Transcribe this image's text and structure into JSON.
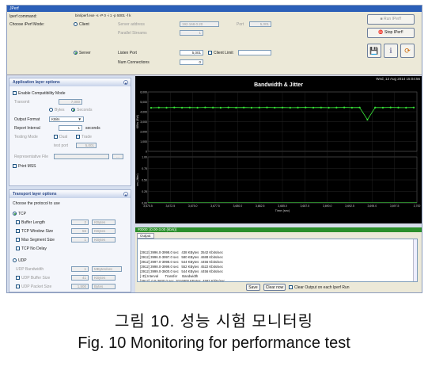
{
  "window": {
    "title": "JPerf"
  },
  "top": {
    "iperf_command_label": "Iperf command:",
    "iperf_command_value": "bin/iperf.exe -s -P 0 -i 1 -p 5001 -f k",
    "mode_label": "Choose iPerf Mode:",
    "client_label": "Client",
    "server_label": "Server",
    "server_address_label": "Server address",
    "server_address_value": "192.168.0.20",
    "port_label": "Port",
    "port_value": "5,001",
    "parallel_label": "Parallel Streams",
    "parallel_value": "1",
    "listen_port_label": "Listen Port",
    "listen_port_value": "5,001",
    "client_limit_label": "Client Limit",
    "num_conn_label": "Num Connections",
    "num_conn_value": "0"
  },
  "buttons": {
    "run": "Run IPerf!",
    "stop": "Stop IPerf!"
  },
  "app_layer": {
    "title": "Application layer options",
    "compat": "Enable Compatibility Mode",
    "transmit_label": "Transmit",
    "transmit_value": "7,000",
    "bytes_label": "Bytes",
    "seconds_label": "Seconds",
    "output_format_label": "Output Format",
    "output_format_value": "KBits",
    "report_interval_label": "Report Interval",
    "report_interval_value": "1",
    "report_interval_unit": "seconds",
    "testing_mode_label": "Testing Mode",
    "dual_label": "Dual",
    "trade_label": "Trade",
    "test_port_label": "test port",
    "test_port_value": "5,001",
    "rep_file_label": "Representative File",
    "print_mss": "Print MSS"
  },
  "transport": {
    "title": "Transport layer options",
    "choose": "Choose the protocol to use",
    "tcp": "TCP",
    "buffer_length": "Buffer Length",
    "buffer_length_value": "2",
    "buffer_length_unit": "KBytes",
    "window_size": "TCP Window Size",
    "window_size_value": "56",
    "window_size_unit": "KBytes",
    "mss": "Max Segment Size",
    "mss_value": "1",
    "mss_unit": "KBytes",
    "no_delay": "TCP No Delay",
    "udp": "UDP",
    "udp_bandwidth": "UDP Bandwidth",
    "udp_bandwidth_value": "1",
    "udp_bandwidth_unit": "MBytes/sec",
    "udp_buffer": "UDP Buffer Size",
    "udp_buffer_value": "41",
    "udp_buffer_unit": "KBytes",
    "udp_packet": "UDP Packet Size",
    "udp_packet_value": "1,500",
    "udp_packet_unit": "Bytes"
  },
  "graph": {
    "title": "Bandwidth & Jitter",
    "date": "Wed, 13 Aug 2014 15:04:56",
    "y1_label": "KBits (BW)",
    "y2_label": "ms (Jitter)",
    "x_label": "Time (sec)"
  },
  "chart_data": {
    "type": "line",
    "title": "Bandwidth & Jitter",
    "xlabel": "Time (sec)",
    "x_ticks": [
      "3,670.5",
      "3,672.5",
      "3,675.0",
      "3,677.5",
      "3,680.0",
      "3,682.5",
      "3,685.0",
      "3,687.5",
      "3,690.0",
      "3,692.5",
      "3,695.0",
      "3,697.5",
      "3,700"
    ],
    "bw_ticks": [
      "6,000",
      "5,000",
      "4,000",
      "3,000",
      "2,000",
      "1,000",
      "0"
    ],
    "jitter_ticks": [
      "1.00",
      "0.75",
      "0.50",
      "0.25",
      "0.00"
    ],
    "bw_series": [
      4400,
      4420,
      4410,
      4430,
      4415,
      4425,
      4410,
      4435,
      4420,
      4410,
      4430,
      4415,
      4425,
      4410,
      4420,
      4430,
      4415,
      4425,
      4410,
      4420,
      4430,
      4415,
      4425,
      4410,
      4420,
      4430,
      4415,
      4425,
      3200,
      4420,
      4415,
      4430,
      4420,
      4410,
      4425
    ],
    "ylim": [
      0,
      6000
    ]
  },
  "output": {
    "header": "#0000: [0.00-3.00 (kb/s)]",
    "tab": "Output",
    "lines": [
      "[3912] 3996.0-3998.0 sec   438 KBytes  3542 Kbits/sec",
      "[3912] 3996.0-3997.0 sec   580 KBytes  4688 Kbits/sec",
      "[3912] 3997.0-3998.0 sec   544 KBytes  4456 Kbits/sec",
      "[3912] 3998.0-3999.0 sec   552 KBytes  4522 Kbits/sec",
      "[3912] 3999.0-3600.0 sec   544 KBytes  4456 Kbits/sec",
      "[ ID] Interval       Transfer     Bandwidth",
      "[3912]  0.0-3600.0 sec  2016800 KBytes  4587 Kbits/sec"
    ],
    "save": "Save",
    "clear": "Clear now",
    "clear_each": "Clear Output on each Iperf Run"
  },
  "caption": {
    "kr": "그림 10. 성능 시험 모니터링",
    "en": "Fig. 10 Monitoring for performance test"
  }
}
